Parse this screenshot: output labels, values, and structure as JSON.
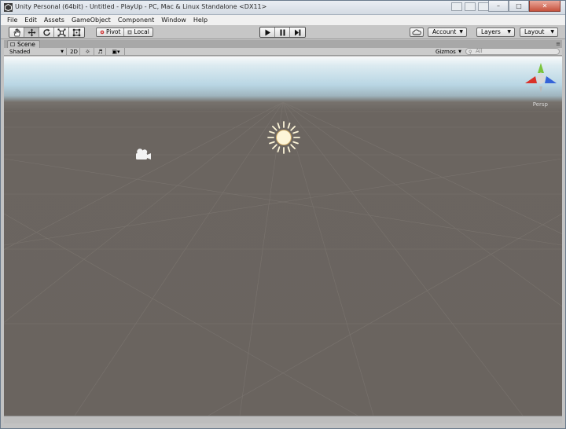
{
  "window": {
    "title": "Unity Personal (64bit) - Untitled - PlayUp - PC, Mac & Linux Standalone <DX11>"
  },
  "menu": [
    "File",
    "Edit",
    "Assets",
    "GameObject",
    "Component",
    "Window",
    "Help"
  ],
  "toolbar": {
    "tools": [
      {
        "name": "hand-tool-icon",
        "active": false
      },
      {
        "name": "move-tool-icon",
        "active": true
      },
      {
        "name": "rotate-tool-icon",
        "active": false
      },
      {
        "name": "scale-tool-icon",
        "active": false
      },
      {
        "name": "rect-tool-icon",
        "active": false
      }
    ],
    "pivot_label": "Pivot",
    "local_label": "Local",
    "account_label": "Account",
    "layers_label": "Layers",
    "layout_label": "Layout"
  },
  "scene": {
    "tab_label": "Scene",
    "shading_mode": "Shaded",
    "mode_2d_label": "2D",
    "gizmos_label": "Gizmos",
    "search_placeholder": "All",
    "projection_label": "Persp"
  },
  "colors": {
    "sky_top": "#f7f9fa",
    "sky_bottom": "#9fb4bd",
    "ground": "#6a645f",
    "gizmo_x": "#d9322a",
    "gizmo_y": "#7ac43c",
    "gizmo_z": "#3463d8",
    "sun": "#fdf5d8"
  }
}
